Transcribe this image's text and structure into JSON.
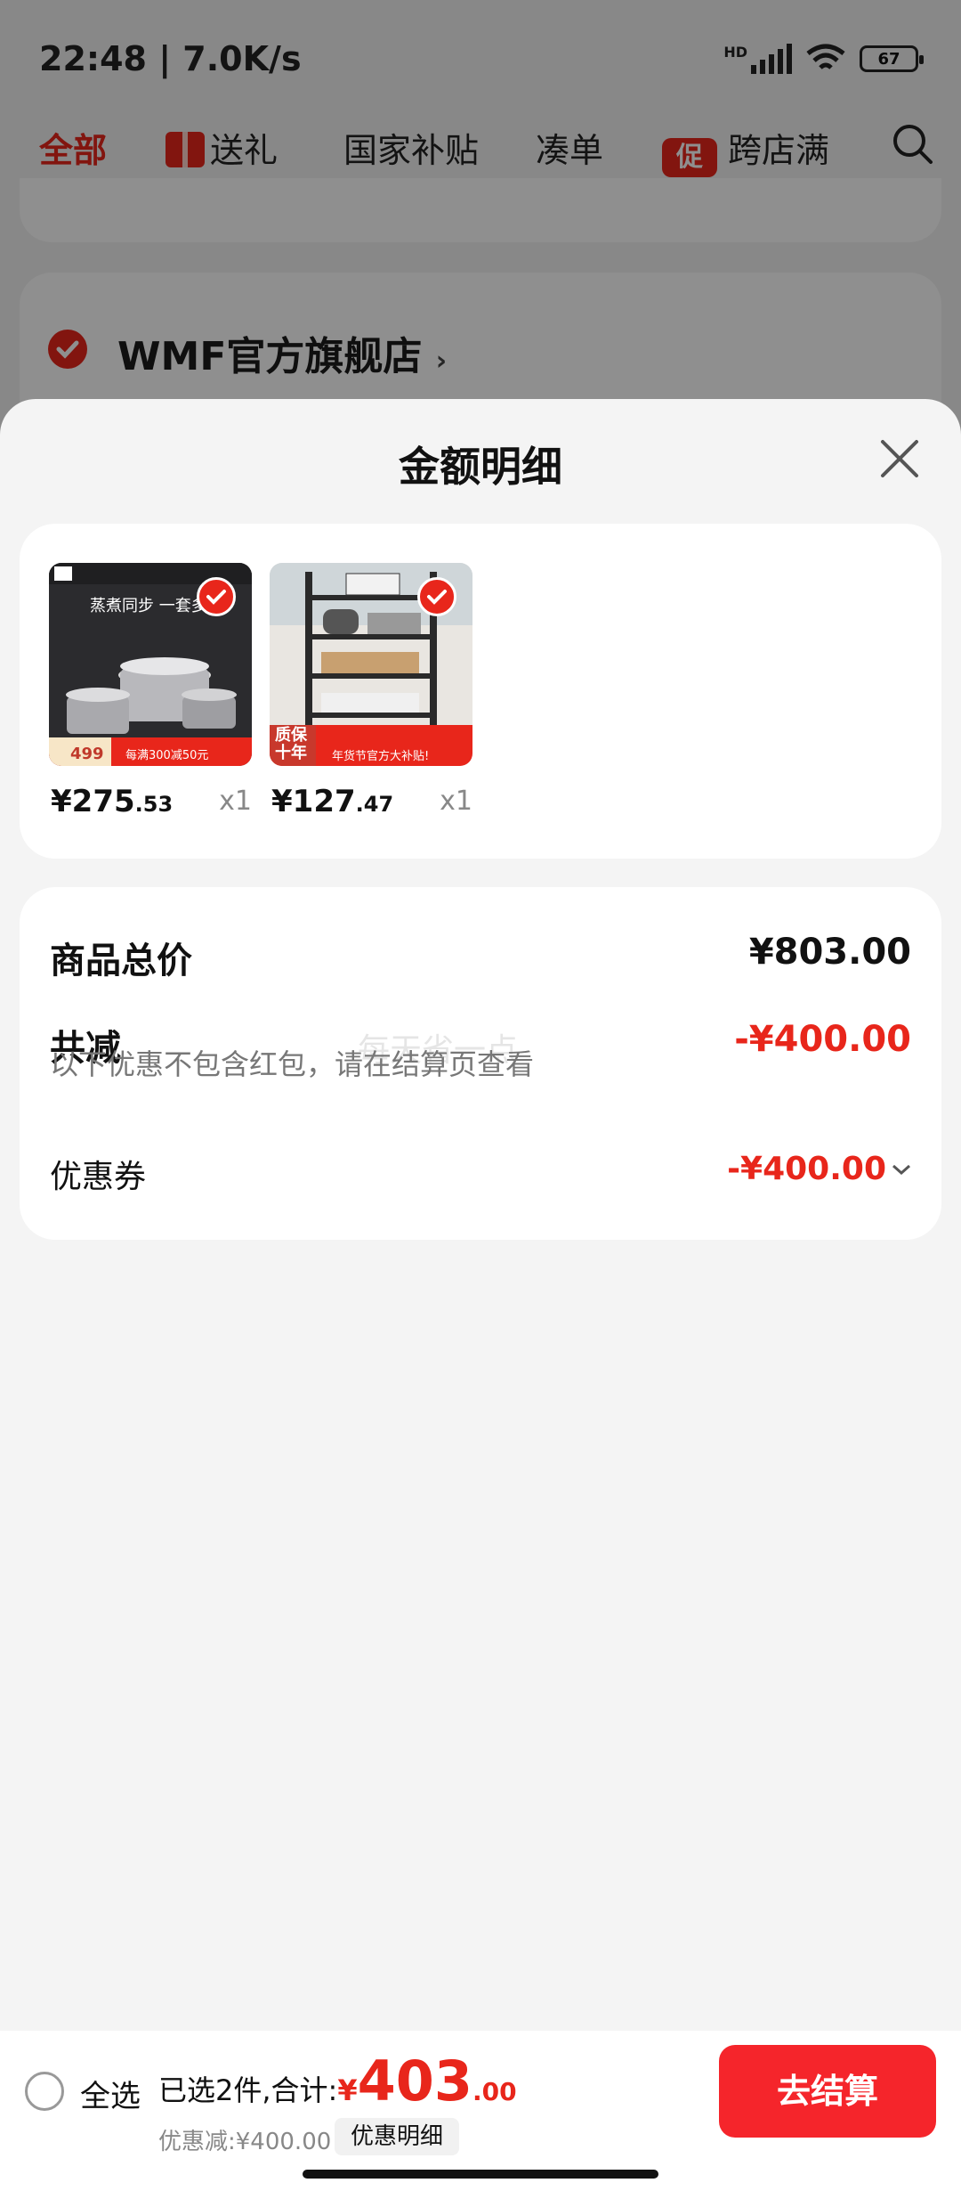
{
  "status_bar": {
    "time_speed": "22:48 | 7.0K/s",
    "network_label": "HD",
    "battery": "67"
  },
  "nav": {
    "tabs": [
      "全部",
      "送礼",
      "国家补贴",
      "凑单",
      "跨店满"
    ],
    "promo_badge": "促"
  },
  "store": {
    "name": "WMF官方旗舰店"
  },
  "sheet": {
    "title": "金额明细",
    "items": [
      {
        "price_int": "¥275",
        "price_dec": ".53",
        "qty": "x1",
        "image": "cookware-pots"
      },
      {
        "price_int": "¥127",
        "price_dec": ".47",
        "qty": "x1",
        "image": "kitchen-rack"
      }
    ],
    "product_image_text": {
      "item1_headline": "蒸煮同步 一套多",
      "item1_price_tag": "499",
      "item1_banner": "每满300减50元",
      "item2_badge": "质保\n十年",
      "item2_banner": "年货节官方大补贴!"
    },
    "summary": {
      "total_label": "商品总价",
      "total_value": "¥803.00",
      "reduce_label": "共减",
      "reduce_value": "-¥400.00",
      "note": "以下优惠不包含红包，请在结算页查看",
      "watermark": "每天省一点",
      "coupon_label": "优惠券",
      "coupon_value": "-¥400.00"
    }
  },
  "bottom_bar": {
    "select_all": "全选",
    "selected_prefix": "已选2件,合计:",
    "currency": "¥",
    "total_int": "403",
    "total_dec": ".00",
    "discount": "优惠减:¥400.00",
    "detail_button": "优惠明细",
    "checkout": "去结算"
  },
  "colors": {
    "accent": "#e8261b",
    "checkout": "#f5252b",
    "background": "#f4f4f4"
  }
}
